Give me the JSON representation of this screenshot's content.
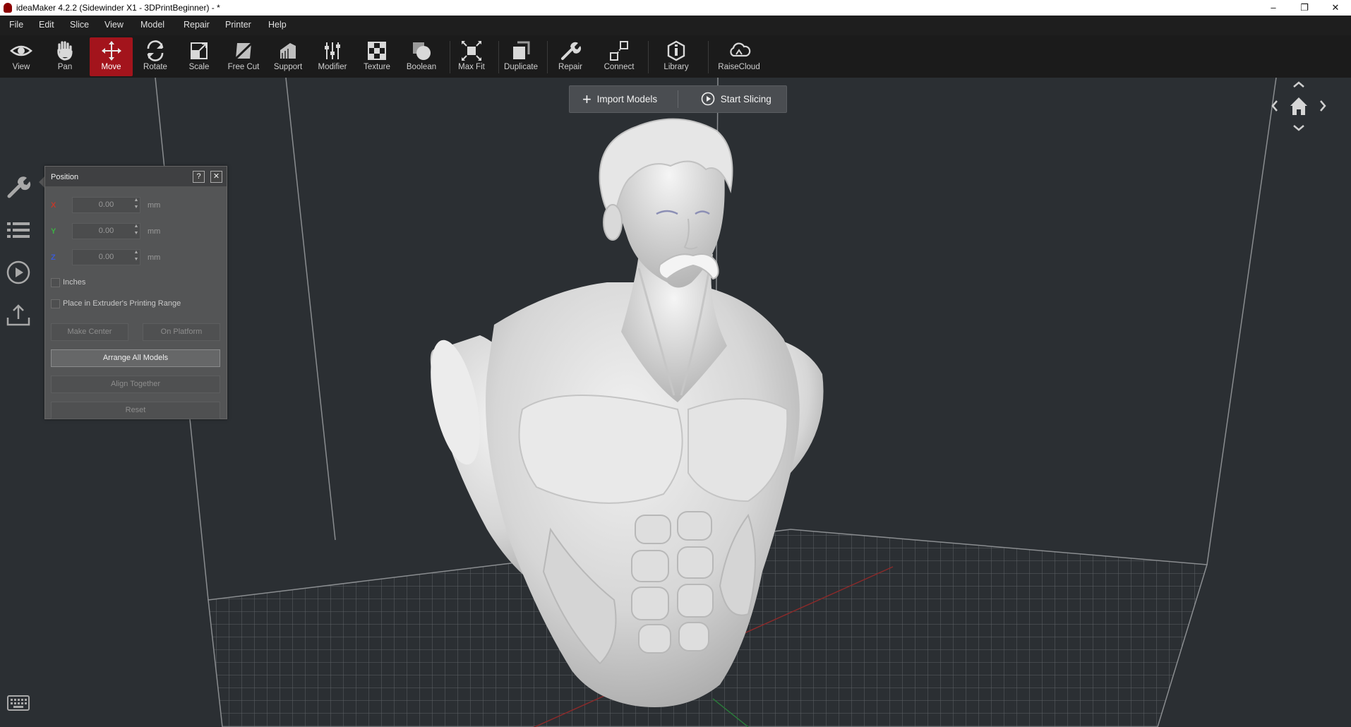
{
  "window": {
    "title": "ideaMaker 4.2.2 (Sidewinder X1 - 3DPrintBeginner) - *",
    "controls": [
      "–",
      "❐",
      "✕"
    ]
  },
  "menu": [
    "File",
    "Edit",
    "Slice",
    "View",
    "Model",
    "Repair",
    "Printer",
    "Help"
  ],
  "toolbar": {
    "view": "View",
    "pan": "Pan",
    "move": "Move",
    "rotate": "Rotate",
    "scale": "Scale",
    "free_cut": "Free Cut",
    "support": "Support",
    "modifier": "Modifier",
    "texture": "Texture",
    "boolean": "Boolean",
    "max_fit": "Max Fit",
    "duplicate": "Duplicate",
    "repair": "Repair",
    "connect": "Connect",
    "library": "Library",
    "raisecloud": "RaiseCloud",
    "active_tool": "Move",
    "active_color": "#a3141c"
  },
  "actions": {
    "import_models": "Import Models",
    "start_slicing": "Start Slicing"
  },
  "side_icons": [
    "wrench-icon",
    "list-icon",
    "play-icon",
    "upload-icon"
  ],
  "position_panel": {
    "title": "Position",
    "help": "?",
    "close": "✕",
    "x_label": "X",
    "y_label": "Y",
    "z_label": "Z",
    "x_value": "0.00",
    "y_value": "0.00",
    "z_value": "0.00",
    "unit": "mm",
    "inches_label": "Inches",
    "extruder_range_label": "Place in Extruder's Printing Range",
    "make_center": "Make Center",
    "on_platform": "On Platform",
    "arrange_all": "Arrange All Models",
    "align_together": "Align Together",
    "reset": "Reset",
    "axis_colors": {
      "x": "#c0392b",
      "y": "#3cb043",
      "z": "#3b5bd6"
    }
  }
}
